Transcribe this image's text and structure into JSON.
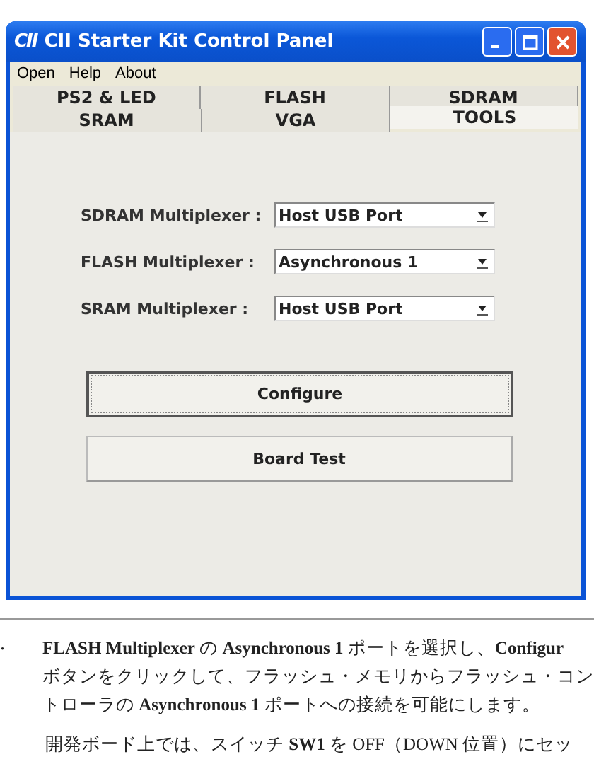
{
  "window": {
    "logo": "CII",
    "title": "CII Starter Kit Control Panel"
  },
  "menu": [
    "Open",
    "Help",
    "About"
  ],
  "tab_rows": [
    [
      {
        "label": "PS2 & LED",
        "selected": false
      },
      {
        "label": "FLASH",
        "selected": false
      },
      {
        "label": "SDRAM",
        "selected": false
      }
    ],
    [
      {
        "label": "SRAM",
        "selected": false
      },
      {
        "label": "VGA",
        "selected": false
      },
      {
        "label": "TOOLS",
        "selected": true
      }
    ]
  ],
  "multiplexers": [
    {
      "label": "SDRAM Multiplexer :",
      "value": "Host USB Port"
    },
    {
      "label": "FLASH Multiplexer :",
      "value": "Asynchronous 1"
    },
    {
      "label": "SRAM Multiplexer :",
      "value": "Host USB Port"
    }
  ],
  "buttons": [
    {
      "label": "Configure",
      "focused": true
    },
    {
      "label": "Board Test",
      "focused": false
    }
  ],
  "document": {
    "list_marker": ".",
    "lines": [
      "**FLASH Multiplexer** の **Asynchronous 1** ポートを選択し、**Configur**",
      "ボタンをクリックして、フラッシュ・メモリからフラッシュ・コン",
      "トローラの **Asynchronous 1** ポートへの接続を可能にします。"
    ],
    "next_paragraph": "開発ボード上では、スイッチ **SW1** を OFF（DOWN 位置）にセッ"
  }
}
